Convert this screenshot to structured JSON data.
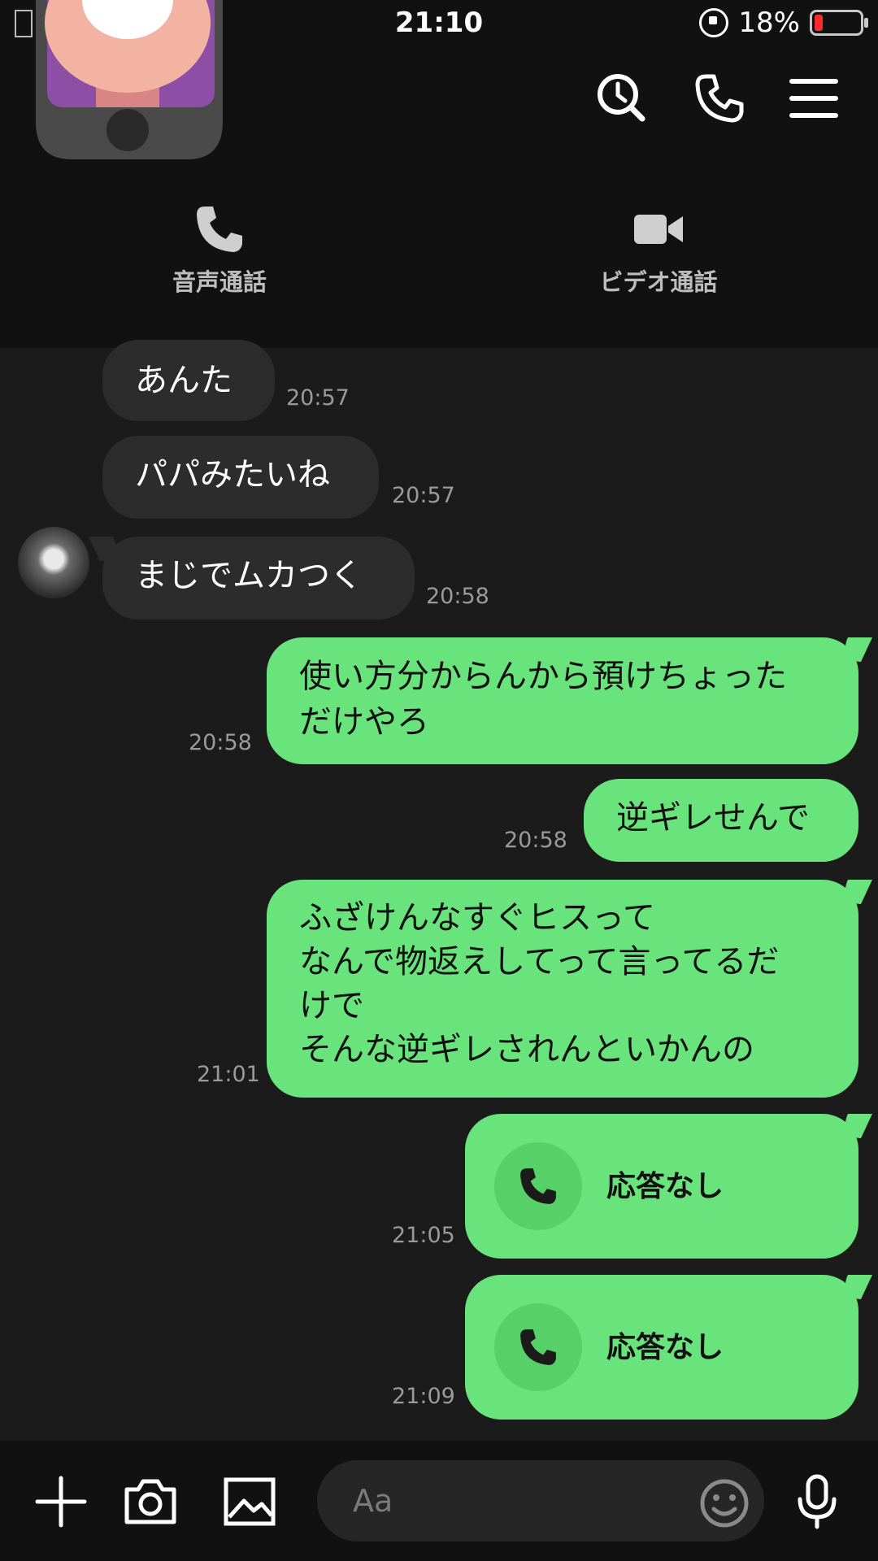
{
  "status_bar": {
    "time": "21:10",
    "battery": "18%",
    "battery_level": 0.18
  },
  "header": {
    "icons": [
      "search-clock-icon",
      "phone-icon",
      "menu-icon"
    ],
    "call_options": [
      {
        "label": "音声通話",
        "icon": "phone-icon"
      },
      {
        "label": "ビデオ通話",
        "icon": "video-camera-icon"
      }
    ]
  },
  "messages": [
    {
      "side": "in",
      "lines": [
        "あんた"
      ],
      "time": "20:57"
    },
    {
      "side": "in",
      "lines": [
        "パパみたいね"
      ],
      "time": "20:57"
    },
    {
      "side": "in",
      "lines": [
        "まじでムカつく"
      ],
      "time": "20:58"
    },
    {
      "side": "out",
      "lines": [
        "使い方分からんから預けちょった",
        "だけやろ"
      ],
      "time": "20:58"
    },
    {
      "side": "out",
      "lines": [
        "逆ギレせんで"
      ],
      "time": "20:58"
    },
    {
      "side": "out",
      "lines": [
        "ふざけんなすぐヒスって",
        "なんで物返えしてって言ってるだ",
        "けで",
        "そんな逆ギレされんといかんの"
      ],
      "time": "21:01"
    },
    {
      "side": "out_call",
      "label": "応答なし",
      "time": "21:05"
    },
    {
      "side": "out_call",
      "label": "応答なし",
      "time": "21:09"
    }
  ],
  "input": {
    "placeholder": "Aa"
  },
  "colors": {
    "bg": "#1b1b1b",
    "header_bg": "#111111",
    "incoming": "#2c2c2c",
    "outgoing": "#69e37b"
  }
}
